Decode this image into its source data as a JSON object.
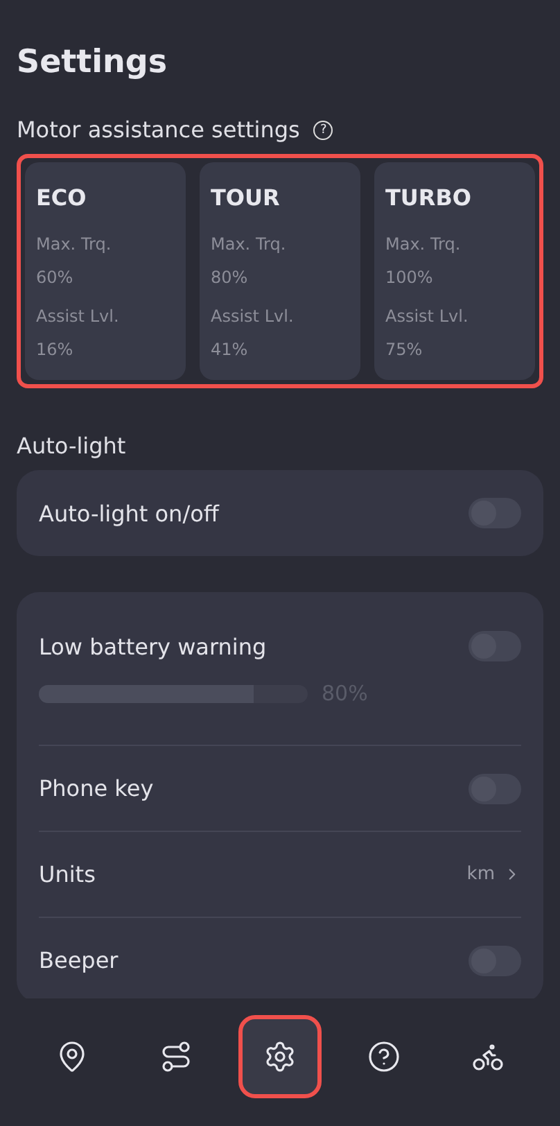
{
  "title": "Settings",
  "motor": {
    "heading": "Motor assistance settings",
    "help": "?",
    "modes": [
      {
        "name": "ECO",
        "torque_label": "Max. Trq.",
        "torque": "60%",
        "assist_label": "Assist Lvl.",
        "assist": "16%"
      },
      {
        "name": "TOUR",
        "torque_label": "Max. Trq.",
        "torque": "80%",
        "assist_label": "Assist Lvl.",
        "assist": "41%"
      },
      {
        "name": "TURBO",
        "torque_label": "Max. Trq.",
        "torque": "100%",
        "assist_label": "Assist Lvl.",
        "assist": "75%"
      }
    ]
  },
  "autolight": {
    "heading": "Auto-light",
    "rows": [
      {
        "kind": "toggle",
        "label": "Auto-light on/off",
        "on": false
      }
    ]
  },
  "general": {
    "rows": [
      {
        "kind": "slider",
        "label": "Low battery warning",
        "on": false,
        "level": 0.8,
        "reading": "80%"
      },
      {
        "kind": "toggle",
        "label": "Phone key",
        "on": false
      },
      {
        "kind": "select",
        "label": "Units",
        "value": "km"
      },
      {
        "kind": "toggle",
        "label": "Beeper",
        "on": false
      }
    ]
  },
  "nav": [
    {
      "kind": "pin",
      "selected": false
    },
    {
      "kind": "route",
      "selected": false
    },
    {
      "kind": "gear",
      "selected": true
    },
    {
      "kind": "help",
      "selected": false
    },
    {
      "kind": "bike",
      "selected": false
    }
  ]
}
